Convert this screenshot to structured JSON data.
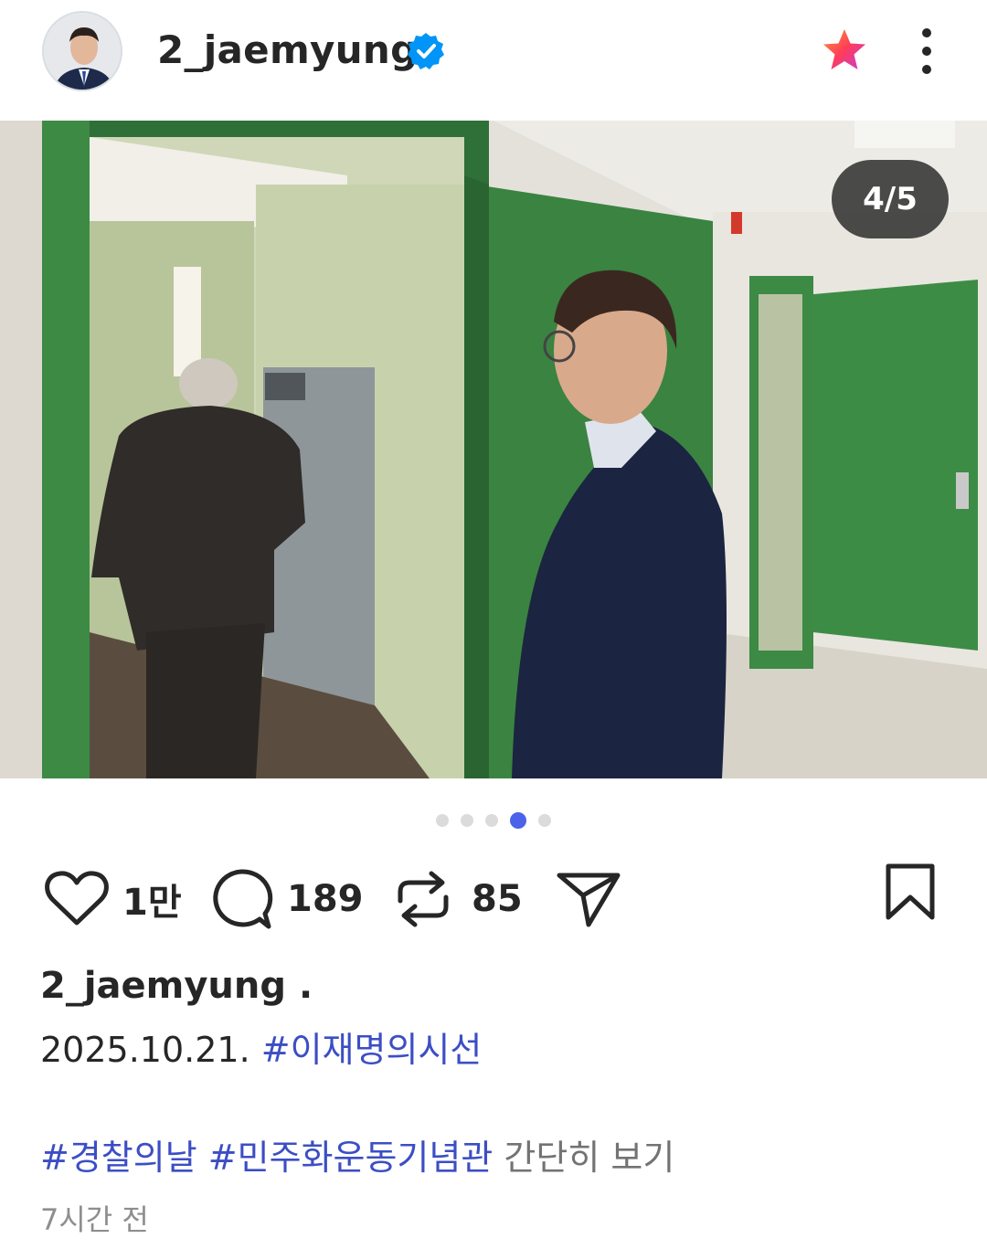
{
  "header": {
    "username": "2_jaemyung"
  },
  "photo": {
    "counter": "4/5",
    "dots_total": 5,
    "dots_active_index": 3
  },
  "actions": {
    "likes": "1만",
    "comments": "189",
    "reposts": "85"
  },
  "caption": {
    "username": "2_jaemyung",
    "suffix": ".",
    "date": "2025.10.21.",
    "hashtag1": "#이재명의시선",
    "hashtag2": "#경찰의날",
    "hashtag3": "#민주화운동기념관",
    "more_label": "간단히 보기",
    "time_ago": "7시간 전"
  },
  "colors": {
    "accent": "#4a63e8",
    "hashtag": "#3c4ec4",
    "verified": "#0095f6"
  }
}
